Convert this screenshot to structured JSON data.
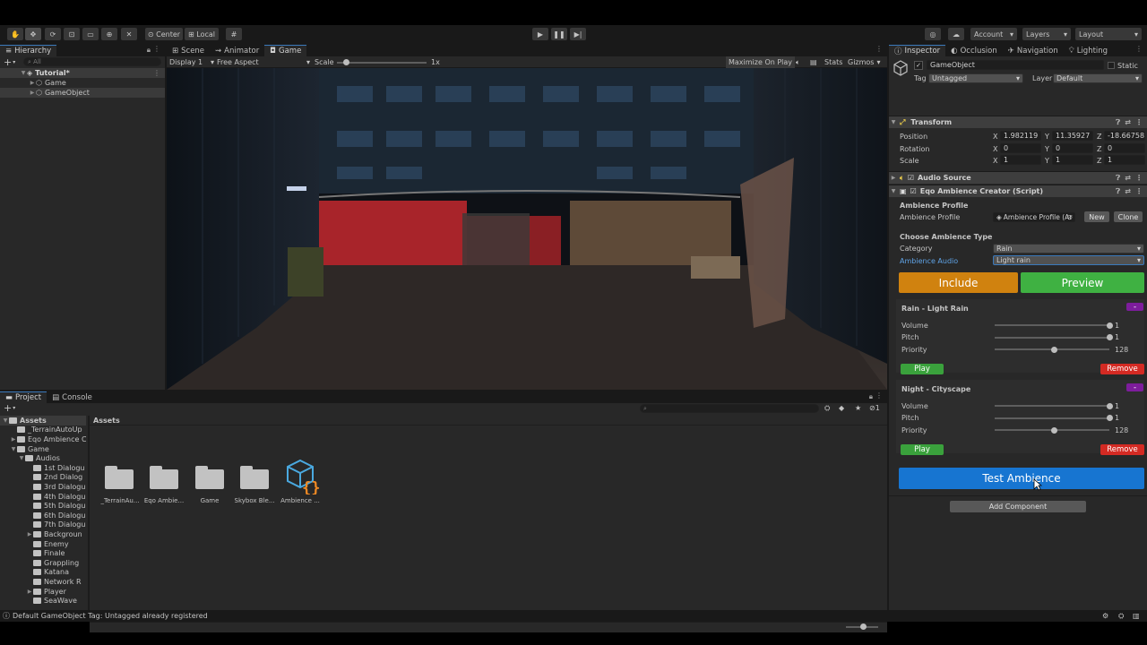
{
  "toolbar": {
    "center_label": "Center",
    "local_label": "Local",
    "account_label": "Account",
    "layers_label": "Layers",
    "layout_label": "Layout"
  },
  "hierarchy": {
    "tab_label": "Hierarchy",
    "search_placeholder": "All",
    "scene_name": "Tutorial*",
    "items": [
      "Game",
      "GameObject"
    ]
  },
  "game_view": {
    "tabs": [
      "Scene",
      "Animator",
      "Game"
    ],
    "display": "Display 1",
    "aspect": "Free Aspect",
    "scale_label": "Scale",
    "scale_value": "1x",
    "scale_level": 0.1,
    "maximize_label": "Maximize On Play",
    "stats_label": "Stats",
    "gizmos_label": "Gizmos"
  },
  "project": {
    "tabs": [
      "Project",
      "Console"
    ],
    "tree": [
      {
        "label": "Assets",
        "level": 0,
        "arrow": "▼"
      },
      {
        "label": "_TerrainAutoUp",
        "level": 1,
        "arrow": ""
      },
      {
        "label": "Eqo Ambience C",
        "level": 1,
        "arrow": "▶"
      },
      {
        "label": "Game",
        "level": 1,
        "arrow": "▼"
      },
      {
        "label": "Audios",
        "level": 2,
        "arrow": "▼"
      },
      {
        "label": "1st Dialogu",
        "level": 3,
        "arrow": ""
      },
      {
        "label": "2nd Dialog",
        "level": 3,
        "arrow": ""
      },
      {
        "label": "3rd Dialogu",
        "level": 3,
        "arrow": ""
      },
      {
        "label": "4th Dialogu",
        "level": 3,
        "arrow": ""
      },
      {
        "label": "5th Dialogu",
        "level": 3,
        "arrow": ""
      },
      {
        "label": "6th Dialogu",
        "level": 3,
        "arrow": ""
      },
      {
        "label": "7th Dialogu",
        "level": 3,
        "arrow": ""
      },
      {
        "label": "Backgroun",
        "level": 3,
        "arrow": "▶"
      },
      {
        "label": "Enemy",
        "level": 3,
        "arrow": ""
      },
      {
        "label": "Finale",
        "level": 3,
        "arrow": ""
      },
      {
        "label": "Grappling",
        "level": 3,
        "arrow": ""
      },
      {
        "label": "Katana",
        "level": 3,
        "arrow": ""
      },
      {
        "label": "Network R",
        "level": 3,
        "arrow": ""
      },
      {
        "label": "Player",
        "level": 3,
        "arrow": "▶"
      },
      {
        "label": "SeaWave",
        "level": 3,
        "arrow": ""
      }
    ],
    "breadcrumb": "Assets",
    "assets": [
      "_TerrainAu...",
      "Eqo Ambie...",
      "Game",
      "Skybox Ble...",
      "Ambience ..."
    ],
    "hidden_count": "1"
  },
  "inspector": {
    "tabs": [
      "Inspector",
      "Occlusion",
      "Navigation",
      "Lighting"
    ],
    "object_name": "GameObject",
    "static_label": "Static",
    "tag_label": "Tag",
    "tag_value": "Untagged",
    "layer_label": "Layer",
    "layer_value": "Default",
    "transform": {
      "title": "Transform",
      "position_label": "Position",
      "rotation_label": "Rotation",
      "scale_label": "Scale",
      "position": [
        "1.982119",
        "11.35927",
        "-18.66758"
      ],
      "rotation": [
        "0",
        "0",
        "0"
      ],
      "scale": [
        "1",
        "1",
        "1"
      ]
    },
    "audio_source_title": "Audio Source",
    "script_title": "Eqo Ambience Creator (Script)",
    "profile_section": "Ambience Profile",
    "profile_label": "Ambience Profile",
    "profile_value": "Ambience Profile (Ar",
    "new_label": "New",
    "clone_label": "Clone",
    "choose_section": "Choose Ambience Type",
    "category_label": "Category",
    "category_value": "Rain",
    "audio_label": "Ambience Audio",
    "audio_value": "Light rain",
    "include_label": "Include",
    "preview_label": "Preview",
    "entries": [
      {
        "title": "Rain - Light Rain",
        "volume": "1",
        "pitch": "1",
        "priority": "128",
        "volume_level": 1.0,
        "pitch_level": 1.0,
        "priority_level": 0.5
      },
      {
        "title": "Night - Cityscape",
        "volume": "1",
        "pitch": "1",
        "priority": "128",
        "volume_level": 1.0,
        "pitch_level": 1.0,
        "priority_level": 0.5
      }
    ],
    "volume_label": "Volume",
    "pitch_label": "Pitch",
    "priority_label": "Priority",
    "play_label": "Play",
    "remove_label": "Remove",
    "minus_label": "-",
    "test_label": "Test Ambience",
    "add_component_label": "Add Component"
  },
  "status": {
    "message": "Default GameObject Tag: Untagged already registered"
  },
  "colors": {
    "include": "#d0820f",
    "preview": "#3fb142",
    "play": "#3aa13c",
    "remove": "#d42a23",
    "minus": "#7d1d9c",
    "test": "#1775d1",
    "accent": "#3a79bb"
  }
}
